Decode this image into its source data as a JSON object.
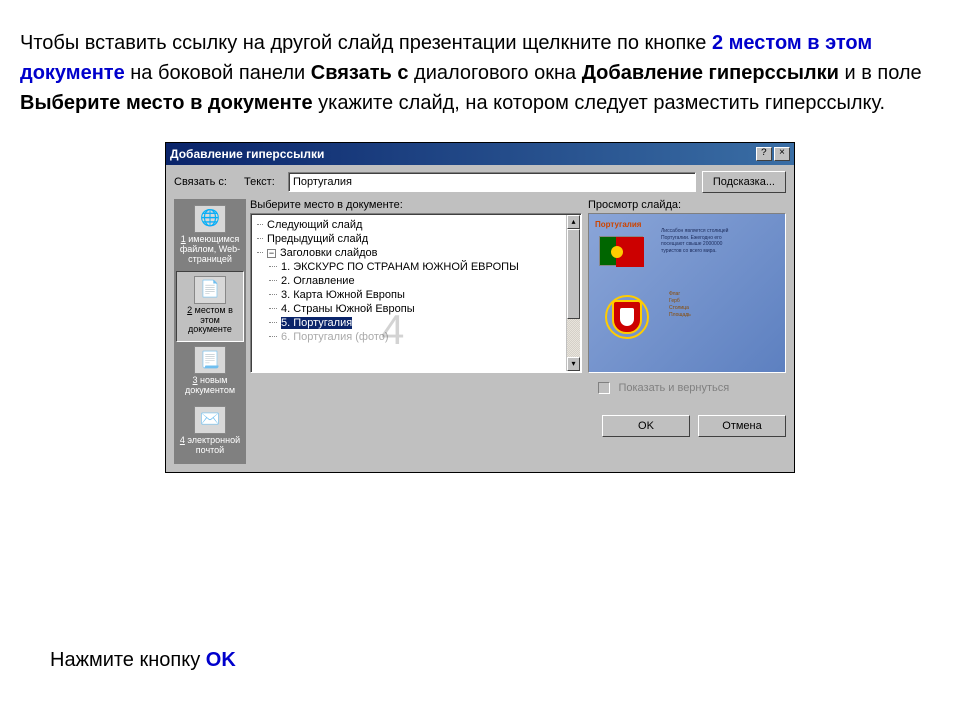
{
  "instruction": {
    "p1a": "Чтобы вставить ссылку на другой слайд презентации щелкните по кнопке ",
    "p1b": "2 местом в этом документе",
    "p1c": " на боковой панели ",
    "p1d": "Связать с",
    "p1e": " диалогового окна ",
    "p1f": "Добавление гиперссылки",
    "p1g": " и в поле ",
    "p1h": "Выберите место в документе",
    "p1i": " укажите слайд, на котором следует разместить гиперссылку."
  },
  "dialog": {
    "title": "Добавление гиперссылки",
    "link_label": "Связать с:",
    "text_label": "Текст:",
    "text_value": "Португалия",
    "hint_btn": "Подсказка...",
    "tree_label": "Выберите место в документе:",
    "preview_label": "Просмотр слайда:",
    "big4": "4",
    "tree": {
      "next": "Следующий слайд",
      "prev": "Предыдущий слайд",
      "section": "Заголовки слайдов",
      "items": [
        "1. ЭКСКУРС ПО СТРАНАМ ЮЖНОЙ ЕВРОПЫ",
        "2. Оглавление",
        "3. Карта Южной Европы",
        "4. Страны Южной Европы",
        "5. Португалия",
        "6. Португалия (фото)"
      ]
    },
    "sidebar": {
      "s1a": "1",
      "s1b": " имеющимся файлом, Web-страницей",
      "s2a": "2",
      "s2b": " местом в этом документе",
      "s3a": "3",
      "s3b": " новым документом",
      "s4a": "4",
      "s4b": " электронной почтой"
    },
    "preview": {
      "title": "Португалия",
      "lines": [
        "Лиссабон является столицей",
        "Португалии. Ежегодно его",
        "посещают свыше 2000000",
        "туристов со всего мира."
      ],
      "bullets": [
        "Флаг",
        "Герб",
        "Столица",
        "Площадь"
      ]
    },
    "checkbox": "Показать и вернуться",
    "ok": "OK",
    "cancel": "Отмена"
  },
  "lower": {
    "a": "Нажмите кнопку ",
    "b": "OK"
  }
}
